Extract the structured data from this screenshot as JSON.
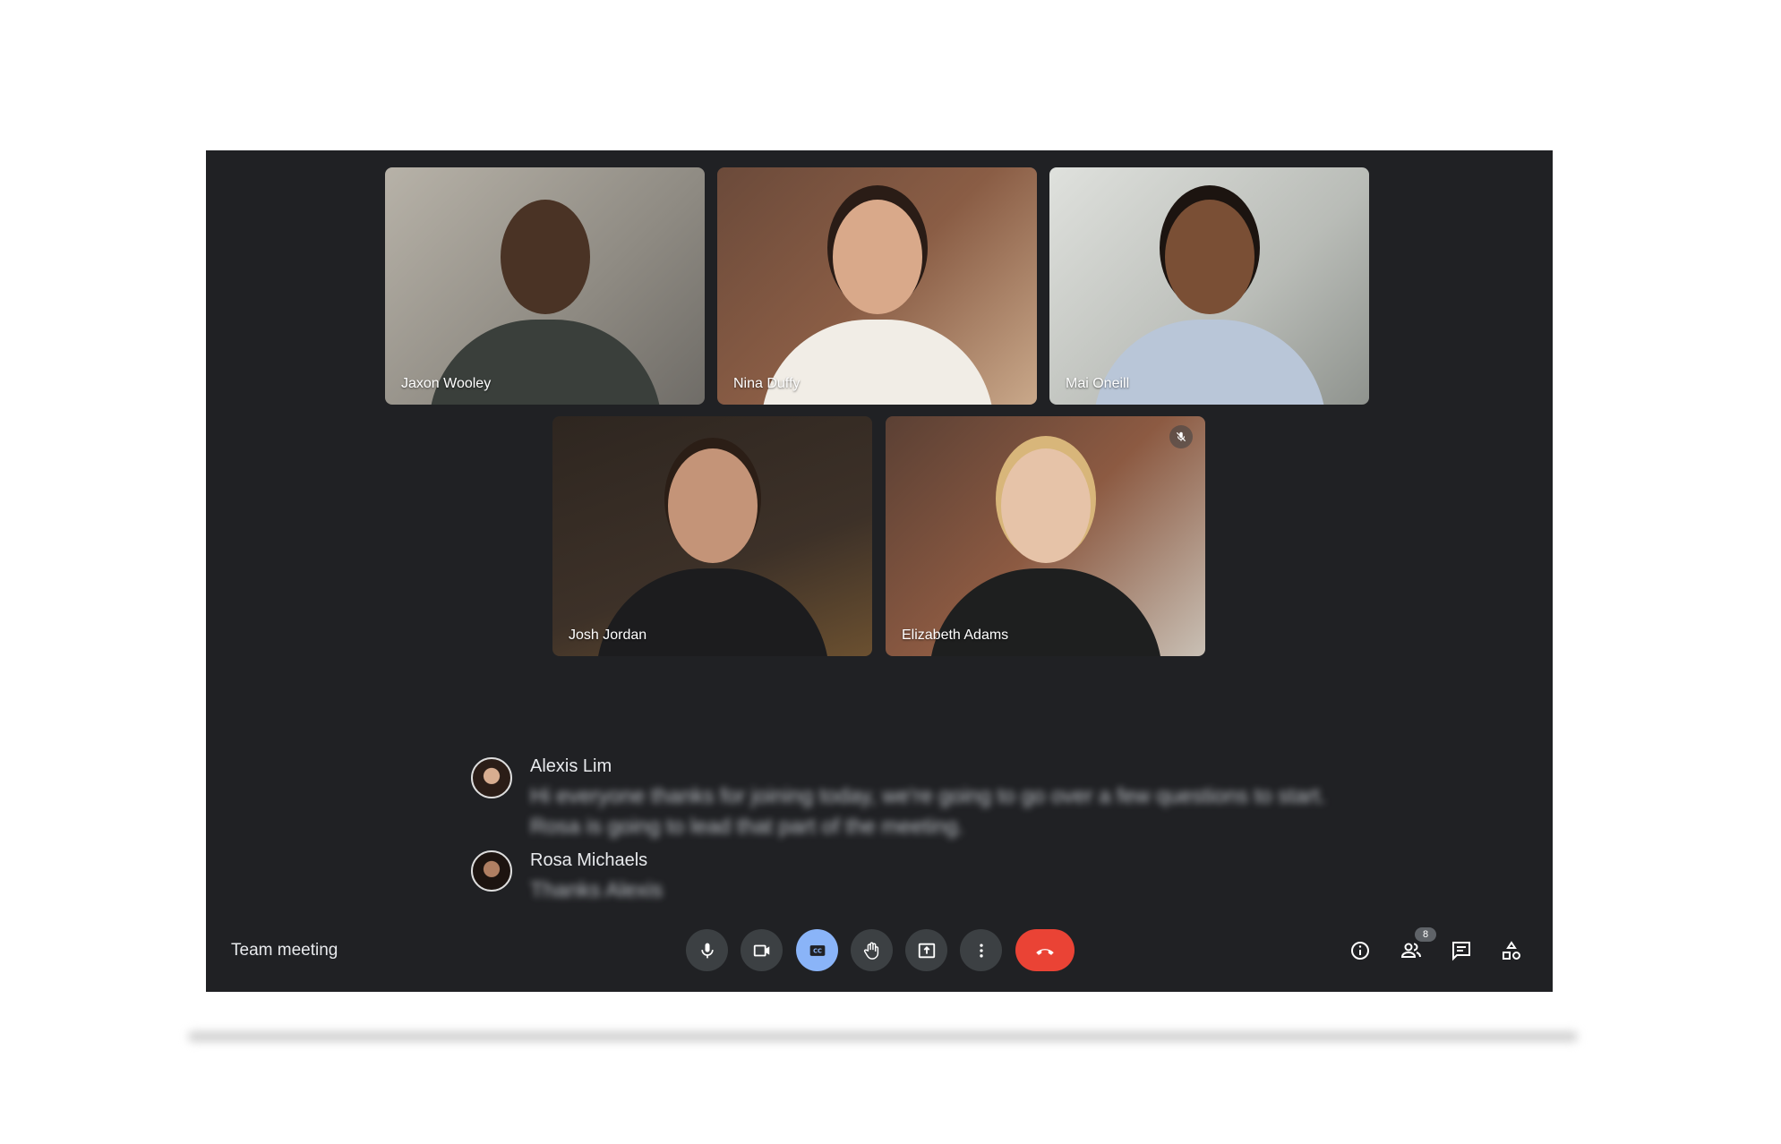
{
  "meeting": {
    "title": "Team meeting"
  },
  "participants": [
    {
      "name": "Jaxon Wooley",
      "muted": false
    },
    {
      "name": "Nina Duffy",
      "muted": false
    },
    {
      "name": "Mai Oneill",
      "muted": false
    },
    {
      "name": "Josh Jordan",
      "muted": false
    },
    {
      "name": "Elizabeth Adams",
      "muted": true
    }
  ],
  "captions": [
    {
      "speaker": "Alexis Lim",
      "text": "Hi everyone thanks for joining today, we're going to go over a few questions to start. Rosa is going to lead that part of the meeting."
    },
    {
      "speaker": "Rosa Michaels",
      "text": "Thanks Alexis"
    }
  ],
  "controls": [
    "mic-icon",
    "camera-icon",
    "captions-icon",
    "raise-hand-icon",
    "present-icon",
    "more-options-icon",
    "end-call-icon"
  ],
  "side_controls": {
    "people_count": "8",
    "icons": [
      "info-icon",
      "people-icon",
      "chat-icon",
      "activities-icon"
    ]
  },
  "colors": {
    "panel": "#202124",
    "button": "#3c4043",
    "captions_active": "#8ab4f8",
    "end_call": "#ea4335"
  }
}
